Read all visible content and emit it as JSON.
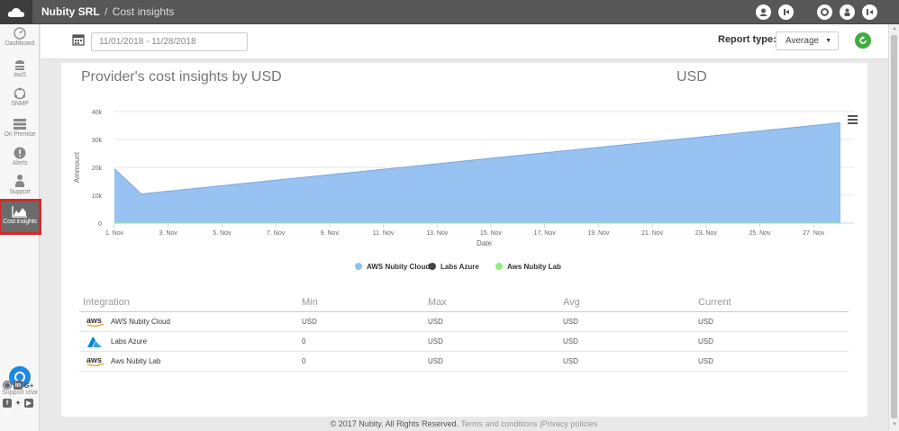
{
  "header": {
    "org": "Nubity SRL",
    "separator": "/",
    "page": "Cost insights",
    "icons": [
      "cloud-icon",
      "user-add-icon",
      "user-menu-icon",
      "settings-icon",
      "profile-icon",
      "logout-icon"
    ]
  },
  "sidebar": {
    "items": [
      {
        "label": "Dashboard",
        "icon": "dashboard-icon"
      },
      {
        "label": "IaaS",
        "icon": "iaas-icon"
      },
      {
        "label": "SNMP",
        "icon": "snmp-icon"
      },
      {
        "label": "On Premise",
        "icon": "server-icon"
      },
      {
        "label": "Alerts",
        "icon": "alert-icon"
      },
      {
        "label": "Support",
        "icon": "support-icon"
      },
      {
        "label": "Cost insights",
        "icon": "chart-icon",
        "active": true
      }
    ],
    "support_chat": "Support chat"
  },
  "toolbar": {
    "date_range": "11/01/2018 - 11/28/2018",
    "report_type_label": "Report type:",
    "report_type_value": "Average"
  },
  "panel": {
    "title": "Provider's cost insights by USD",
    "unit": "USD"
  },
  "chart_data": {
    "type": "area",
    "xlabel": "Date",
    "ylabel": "Ammount",
    "ylim": [
      0,
      40000
    ],
    "yticks": [
      "0",
      "10k",
      "20k",
      "30k",
      "40k"
    ],
    "xticks": [
      "1. Nov",
      "3. Nov",
      "5. Nov",
      "7. Nov",
      "9. Nov",
      "11. Nov",
      "13. Nov",
      "15. Nov",
      "17. Nov",
      "19. Nov",
      "21. Nov",
      "23. Nov",
      "25. Nov",
      "27. Nov"
    ],
    "grid": true,
    "legend_position": "bottom",
    "series": [
      {
        "name": "AWS Nubity Cloud",
        "color": "#91bff0",
        "x": [
          1,
          2,
          28
        ],
        "values": [
          19500,
          10500,
          36000
        ]
      },
      {
        "name": "Labs Azure",
        "color": "#434348",
        "x": [
          1,
          28
        ],
        "values": [
          0,
          0
        ]
      },
      {
        "name": "Aws Nubity Lab",
        "color": "#90ed7d",
        "x": [
          1,
          28
        ],
        "values": [
          0,
          0
        ]
      }
    ]
  },
  "table": {
    "headers": [
      "Integration",
      "Min",
      "Max",
      "Avg",
      "Current"
    ],
    "rows": [
      {
        "name": "AWS Nubity Cloud",
        "icon": "aws-icon",
        "min": "USD",
        "max": "USD",
        "avg": "USD",
        "current": "USD"
      },
      {
        "name": "Labs Azure",
        "icon": "azure-icon",
        "min": "0",
        "max": "USD",
        "avg": "USD",
        "current": "USD"
      },
      {
        "name": "Aws Nubity Lab",
        "icon": "aws-icon",
        "min": "0",
        "max": "USD",
        "avg": "USD",
        "current": "USD"
      }
    ]
  },
  "footer": {
    "copyright": "© 2017 Nubity. All Rights Reserved.",
    "terms": "Terms and conditions",
    "divider": "|",
    "privacy": "Privacy policies"
  },
  "colors": {
    "topbar": "#575757",
    "accent_active": "#d42a2a",
    "refresh": "#3fae3f",
    "chat": "#1e88e5",
    "aws": "#f39c12",
    "azure": "#0089d6"
  }
}
